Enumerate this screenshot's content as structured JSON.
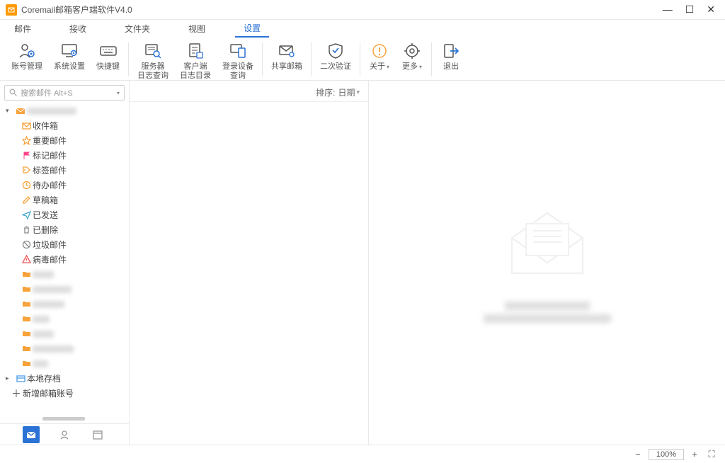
{
  "window": {
    "title": "Coremail邮箱客户端软件V4.0"
  },
  "menu": {
    "items": [
      "邮件",
      "接收",
      "文件夹",
      "视图",
      "设置"
    ],
    "active_index": 4
  },
  "ribbon": {
    "account_mgmt": "账号管理",
    "system_settings": "系统设置",
    "hotkeys": "快捷键",
    "server_log": "服务器\n日志查询",
    "client_log": "客户端\n日志目录",
    "device_query": "登录设备\n查询",
    "shared_mailbox": "共享邮箱",
    "two_factor": "二次验证",
    "about": "关于",
    "more": "更多",
    "exit": "退出"
  },
  "search": {
    "placeholder": "搜索邮件  Alt+S"
  },
  "tree": {
    "inbox": "收件箱",
    "important": "重要邮件",
    "flagged": "标记邮件",
    "tagged": "标签邮件",
    "todo": "待办邮件",
    "drafts": "草稿箱",
    "sent": "已发送",
    "deleted": "已删除",
    "junk": "垃圾邮件",
    "virus": "病毒邮件",
    "local": "本地存档",
    "add_account": "新增邮箱账号"
  },
  "sort": {
    "label": "排序:",
    "value": "日期"
  },
  "status": {
    "zoom": "100%"
  },
  "colors": {
    "accent": "#2a72d6",
    "orange": "#f7a23b",
    "icon_gray": "#999"
  }
}
